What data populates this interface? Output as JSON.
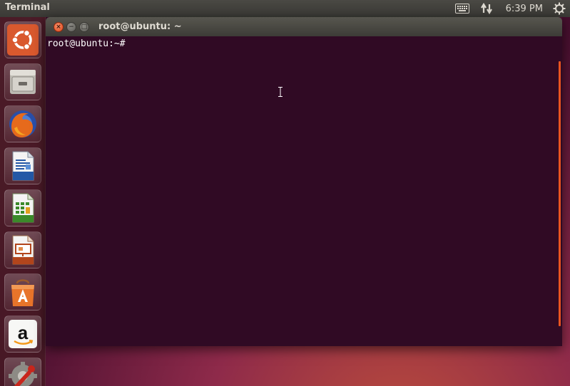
{
  "top_panel": {
    "app_title": "Terminal",
    "clock": "6:39 PM",
    "indicators": [
      "keyboard-icon",
      "network-arrows-icon",
      "power-gear-icon"
    ]
  },
  "launcher": {
    "items": [
      {
        "name": "dash-home",
        "icon": "ubuntu-logo-icon"
      },
      {
        "name": "files",
        "icon": "file-cabinet-icon"
      },
      {
        "name": "firefox",
        "icon": "firefox-icon"
      },
      {
        "name": "libreoffice-writer",
        "icon": "writer-document-icon"
      },
      {
        "name": "libreoffice-calc",
        "icon": "calc-spreadsheet-icon"
      },
      {
        "name": "libreoffice-impress",
        "icon": "impress-presentation-icon"
      },
      {
        "name": "ubuntu-software-center",
        "icon": "software-bag-icon"
      },
      {
        "name": "amazon",
        "icon": "amazon-icon"
      },
      {
        "name": "system-settings",
        "icon": "settings-wrench-icon"
      }
    ]
  },
  "window": {
    "title": "root@ubuntu: ~",
    "buttons": {
      "close": "×",
      "minimize": "−",
      "maximize": "□"
    }
  },
  "terminal": {
    "prompt": "root@ubuntu:~#"
  },
  "colors": {
    "terminal_bg": "#300a24",
    "accent": "#e95420",
    "panel_bg": "#3c3b37",
    "text": "#dfdbd2"
  }
}
